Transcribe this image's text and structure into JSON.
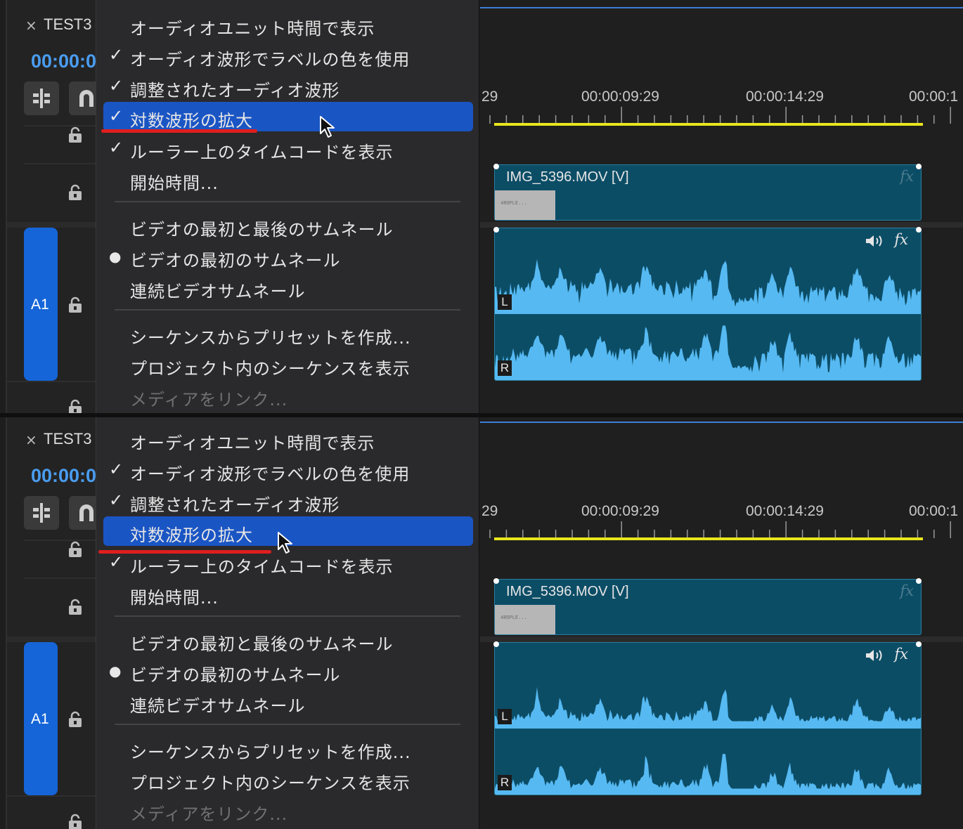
{
  "panels": [
    {
      "sequence_name": "TEST3",
      "timecode": "00:00:0",
      "track_label": "A1",
      "ruler_labels": [
        "29",
        "00:00:09:29",
        "00:00:14:29",
        "00:00:1"
      ],
      "video_clip_name": "IMG_5396.MOV [V]",
      "fx_label": "fx",
      "channel_left": "L",
      "channel_right": "R",
      "thumbnail_text": "4ROPLE...",
      "menu": {
        "items": [
          {
            "label": "オーディオユニット時間で表示",
            "mark": ""
          },
          {
            "label": "オーディオ波形でラベルの色を使用",
            "mark": "✓"
          },
          {
            "label": "調整されたオーディオ波形",
            "mark": "✓"
          },
          {
            "label": "対数波形の拡大",
            "mark": "✓",
            "highlighted": true
          },
          {
            "label": "ルーラー上のタイムコードを表示",
            "mark": "✓"
          },
          {
            "label": "開始時間...",
            "mark": ""
          },
          {
            "label": "ビデオの最初と最後のサムネール",
            "mark": ""
          },
          {
            "label": "ビデオの最初のサムネール",
            "mark": "●"
          },
          {
            "label": "連続ビデオサムネール",
            "mark": ""
          },
          {
            "label": "シーケンスからプリセットを作成...",
            "mark": ""
          },
          {
            "label": "プロジェクト内のシーケンスを表示",
            "mark": ""
          },
          {
            "label": "メディアをリンク...",
            "mark": "",
            "disabled": true
          }
        ]
      }
    },
    {
      "sequence_name": "TEST3",
      "timecode": "00:00:0",
      "track_label": "A1",
      "ruler_labels": [
        "29",
        "00:00:09:29",
        "00:00:14:29",
        "00:00:1"
      ],
      "video_clip_name": "IMG_5396.MOV [V]",
      "fx_label": "fx",
      "channel_left": "L",
      "channel_right": "R",
      "thumbnail_text": "4ROPLE...",
      "menu": {
        "items": [
          {
            "label": "オーディオユニット時間で表示",
            "mark": ""
          },
          {
            "label": "オーディオ波形でラベルの色を使用",
            "mark": "✓"
          },
          {
            "label": "調整されたオーディオ波形",
            "mark": "✓"
          },
          {
            "label": "対数波形の拡大",
            "mark": "",
            "highlighted": true
          },
          {
            "label": "ルーラー上のタイムコードを表示",
            "mark": "✓"
          },
          {
            "label": "開始時間...",
            "mark": ""
          },
          {
            "label": "ビデオの最初と最後のサムネール",
            "mark": ""
          },
          {
            "label": "ビデオの最初のサムネール",
            "mark": "●"
          },
          {
            "label": "連続ビデオサムネール",
            "mark": ""
          },
          {
            "label": "シーケンスからプリセットを作成...",
            "mark": ""
          },
          {
            "label": "プロジェクト内のシーケンスを表示",
            "mark": ""
          },
          {
            "label": "メディアをリンク...",
            "mark": "",
            "disabled": true
          }
        ]
      }
    }
  ],
  "colors": {
    "accent_blue": "#1565d8",
    "menu_highlight": "#1a55c4",
    "clip_teal": "#0c4d66",
    "waveform": "#56b9f2",
    "work_area_yellow": "#e9e51d",
    "annotation_red": "#e01e1e"
  },
  "icons": {
    "close": "close-icon",
    "snap": "snap-insert-icon",
    "magnet": "magnet-icon",
    "lock": "lock-icon",
    "speaker": "speaker-icon",
    "cursor": "mouse-cursor-icon"
  }
}
